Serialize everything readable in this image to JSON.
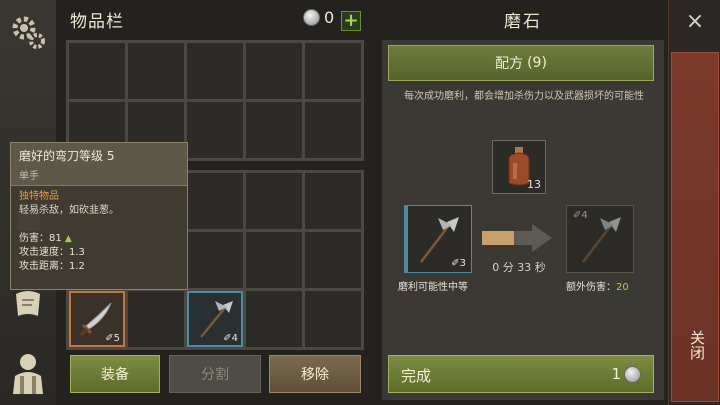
{
  "inventory": {
    "title": "物品栏",
    "coins": "0",
    "plus": "+",
    "items": [
      {
        "count": "5",
        "icon": "sword-icon"
      },
      {
        "count": "4",
        "icon": "halberd-icon"
      }
    ]
  },
  "tooltip": {
    "title": "磨好的弯刀等级 5",
    "subtitle": "单手",
    "unique": "独特物品",
    "flavor": "轻易杀敌，如砍韭葱。",
    "damage_label": "伤害：",
    "damage_value": "81",
    "attack_speed_label": "攻击速度：",
    "attack_speed_value": "1.3",
    "attack_range_label": "攻击距离：",
    "attack_range_value": "1.2"
  },
  "buttons": {
    "equip": "装备",
    "split": "分割",
    "remove": "移除"
  },
  "craft": {
    "title": "磨石",
    "recipe_label": "配方",
    "recipe_count": "(9)",
    "description": "每次成功磨利，都会增加杀伤力以及武器损坏的可能性",
    "bottle_count": "13",
    "input_count": "3",
    "output_count": "4",
    "timer": "0 分 33 秒",
    "sharpen_chance": "磨利可能性中等",
    "extra_damage_label": "额外伤害：",
    "extra_damage_value": "20",
    "complete_label": "完成",
    "complete_cost": "1"
  },
  "close": {
    "label": "关闭",
    "x": "×"
  },
  "colors": {
    "accent_green": "#6f7c3e",
    "close_red": "#7a3a2c",
    "unique_orange": "#e39b3d",
    "stat_up_green": "#9fd24c"
  }
}
